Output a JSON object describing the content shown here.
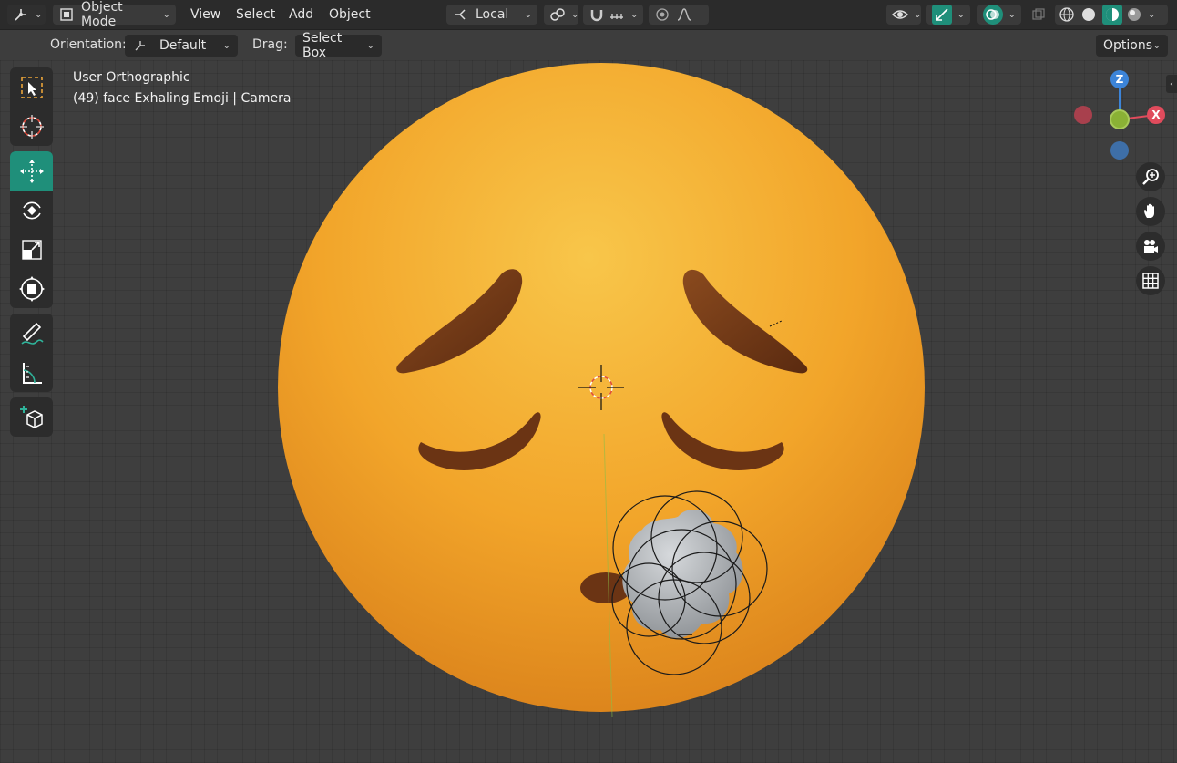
{
  "header": {
    "mode_label": "Object Mode",
    "menu": [
      "View",
      "Select",
      "Add",
      "Object"
    ],
    "transform_space": "Local",
    "options_label": "Options"
  },
  "toolbar2": {
    "orientation_label": "Orientation:",
    "orientation_value": "Default",
    "drag_label": "Drag:",
    "drag_value": "Select Box"
  },
  "viewport": {
    "view_name": "User Orthographic",
    "object_info": "(49) face Exhaling Emoji | Camera"
  },
  "gizmo": {
    "z": "Z",
    "x": "X",
    "colors": {
      "x": "#e04b5c",
      "y": "#8ab135",
      "z": "#3c84d8"
    }
  },
  "colors": {
    "accent": "#1f8f7a",
    "face": "#f2a52a",
    "brow": "#6b3414",
    "cloud": "#b9bcbf"
  }
}
